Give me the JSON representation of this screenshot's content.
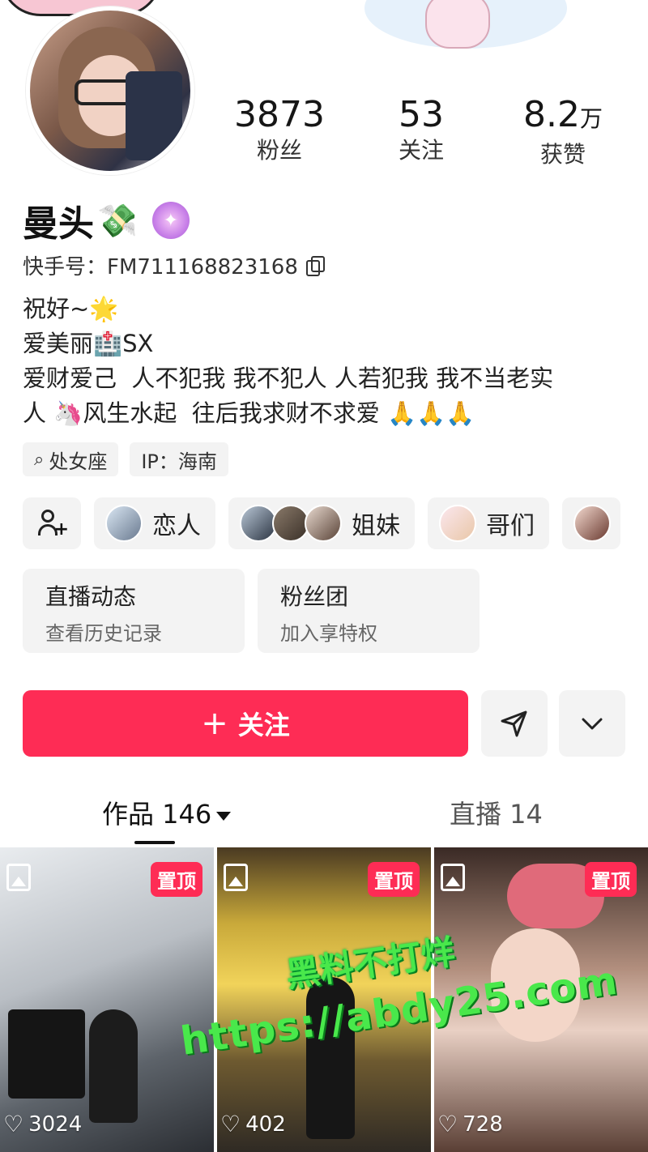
{
  "profile": {
    "name": "曼头",
    "name_emoji": "💸",
    "kuaishou_id": "快手号：FM711168823168",
    "bio": "祝好~🌟\n爱美丽🏥SX\n爱财爱己  人不犯我 我不犯人 人若犯我 我不当老实\n人 🦄风生水起  往后我求财不求爱￼ 🙏🙏🙏"
  },
  "stats": [
    {
      "value": "3873",
      "label": "粉丝"
    },
    {
      "value": "53",
      "label": "关注"
    },
    {
      "value": "8.2",
      "unit": "万",
      "label": "获赞"
    }
  ],
  "tags": [
    {
      "icon": "pin-icon",
      "text": "处女座"
    },
    {
      "text": "IP：海南"
    }
  ],
  "groups": [
    {
      "label": "恋人"
    },
    {
      "label": "姐妹"
    },
    {
      "label": "哥们"
    }
  ],
  "cards": [
    {
      "title": "直播动态",
      "subtitle": "查看历史记录"
    },
    {
      "title": "粉丝团",
      "subtitle": "加入享特权"
    }
  ],
  "actions": {
    "follow_label": "关注",
    "follow_plus": "+"
  },
  "tabs": {
    "works": "作品 146",
    "live": "直播 14"
  },
  "posts": [
    {
      "badge": "置顶",
      "likes": "3024"
    },
    {
      "badge": "置顶",
      "likes": "402"
    },
    {
      "badge": "置顶",
      "likes": "728"
    }
  ],
  "watermark": {
    "line1": "黑料不打烊",
    "line2": "https://abdy25.com"
  },
  "colors": {
    "accent": "#fe2c55",
    "chip_bg": "#f3f3f3",
    "watermark": "#49e84b"
  }
}
